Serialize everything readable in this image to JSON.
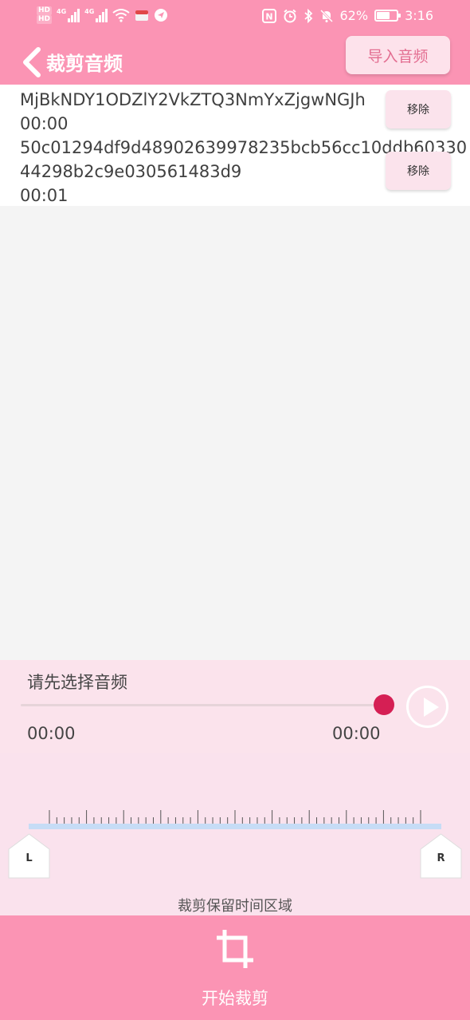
{
  "status_bar": {
    "hd1": "HD",
    "hd2": "HD",
    "net1": "4G",
    "net2": "4G",
    "nfc": "N",
    "battery_percent": "62%",
    "time": "3:16"
  },
  "header": {
    "title": "裁剪音频",
    "import_label": "导入音频"
  },
  "files": [
    {
      "name_line1": "MjBkNDY1ODZlY2VkZTQ3NmYxZjgwNGJh",
      "name_line2": "",
      "duration": "00:00",
      "remove_label": "移除"
    },
    {
      "name_line1": "50c01294df9d48902639978235bcb56cc10ddb60330",
      "name_line2": "44298b2c9e030561483d9",
      "duration": "00:01",
      "remove_label": "移除"
    }
  ],
  "player": {
    "status": "请先选择音频",
    "progress_fraction": 1.0,
    "time_start": "00:00",
    "time_end": "00:00"
  },
  "trim": {
    "left_handle": "L",
    "right_handle": "R",
    "caption": "裁剪保留时间区域"
  },
  "bottom": {
    "crop_label": "开始裁剪"
  },
  "colors": {
    "primary": "#fb94b4",
    "accent": "#d51f54",
    "light": "#fbe3ec"
  }
}
